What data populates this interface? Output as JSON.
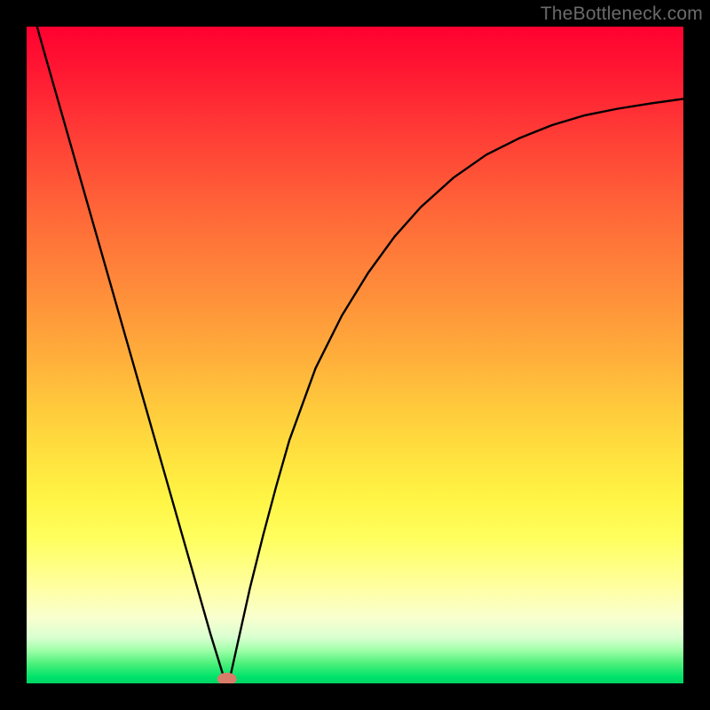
{
  "watermark": "TheBottleneck.com",
  "chart_data": {
    "type": "line",
    "title": "",
    "xlabel": "",
    "ylabel": "",
    "xlim": [
      0,
      1
    ],
    "ylim": [
      0,
      1
    ],
    "x": [
      0.0,
      0.02,
      0.04,
      0.06,
      0.08,
      0.1,
      0.12,
      0.14,
      0.16,
      0.18,
      0.2,
      0.22,
      0.24,
      0.26,
      0.28,
      0.3,
      0.305,
      0.31,
      0.32,
      0.34,
      0.36,
      0.38,
      0.4,
      0.44,
      0.48,
      0.52,
      0.56,
      0.6,
      0.65,
      0.7,
      0.75,
      0.8,
      0.85,
      0.9,
      0.95,
      1.0
    ],
    "values": [
      1.06,
      0.985,
      0.915,
      0.845,
      0.775,
      0.705,
      0.635,
      0.565,
      0.495,
      0.425,
      0.355,
      0.285,
      0.215,
      0.145,
      0.075,
      0.01,
      0.0,
      0.01,
      0.055,
      0.145,
      0.225,
      0.3,
      0.37,
      0.48,
      0.56,
      0.625,
      0.68,
      0.725,
      0.77,
      0.805,
      0.83,
      0.85,
      0.865,
      0.875,
      0.883,
      0.89
    ],
    "marker_x": 0.305,
    "marker_y": 0.0
  }
}
